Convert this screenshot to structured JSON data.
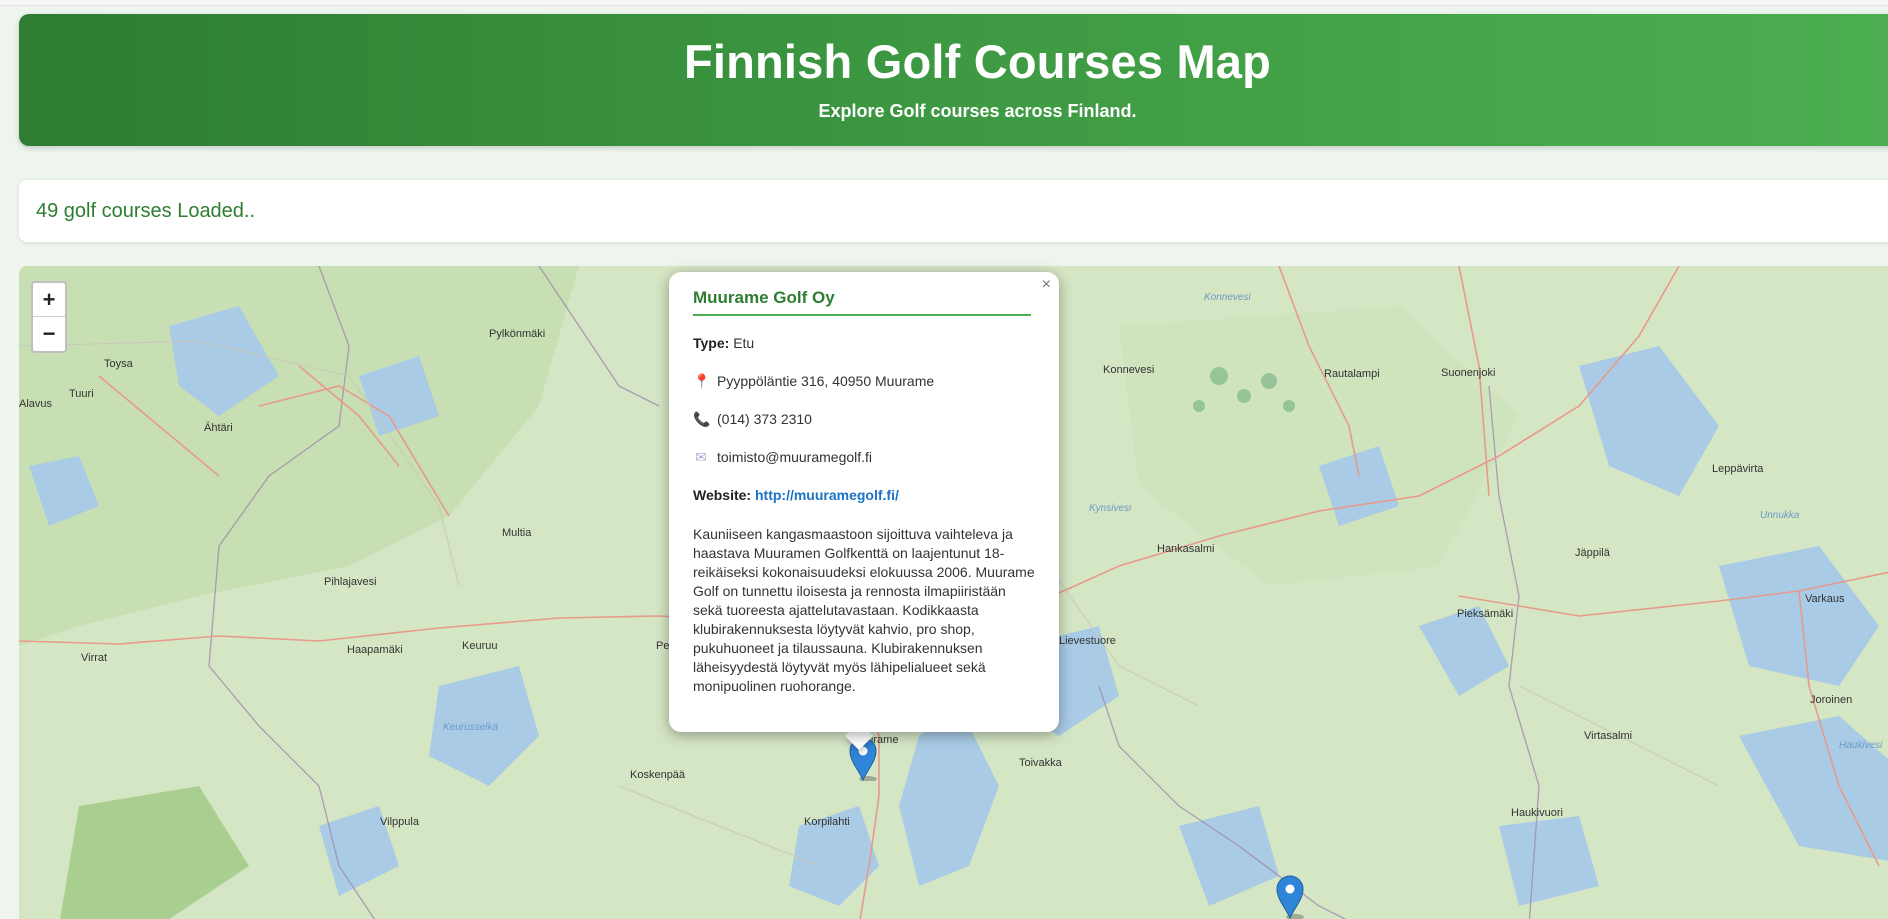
{
  "header": {
    "title": "Finnish Golf Courses Map",
    "subtitle": "Explore Golf courses across Finland."
  },
  "status": {
    "text": "49 golf courses Loaded.."
  },
  "map": {
    "zoom_in_label": "+",
    "zoom_out_label": "−",
    "places": [
      {
        "name": "Pylkönmäki"
      },
      {
        "name": "Toysa"
      },
      {
        "name": "Tuuri"
      },
      {
        "name": "Alavus"
      },
      {
        "name": "Ähtäri"
      },
      {
        "name": "Multia"
      },
      {
        "name": "Pihlajavesi"
      },
      {
        "name": "Haapamäki"
      },
      {
        "name": "Keuruu"
      },
      {
        "name": "Virrat"
      },
      {
        "name": "Koskenpää"
      },
      {
        "name": "Vilppula"
      },
      {
        "name": "Muurame"
      },
      {
        "name": "Korpilahti"
      },
      {
        "name": "Toivakka"
      },
      {
        "name": "Lievestuore"
      },
      {
        "name": "Hankasalmi"
      },
      {
        "name": "Konnevesi"
      },
      {
        "name": "Rautalampi"
      },
      {
        "name": "Suonenjoki"
      },
      {
        "name": "Leppävirta"
      },
      {
        "name": "Jäppilä"
      },
      {
        "name": "Pieksämäki"
      },
      {
        "name": "Varkaus"
      },
      {
        "name": "Joroinen"
      },
      {
        "name": "Virtasalmi"
      },
      {
        "name": "Haukivuori"
      },
      {
        "name": "Pe"
      }
    ],
    "water_labels": [
      {
        "name": "Konnevesi"
      },
      {
        "name": "Kynsivesi"
      },
      {
        "name": "Unnukka"
      },
      {
        "name": "Keurusselkä"
      },
      {
        "name": "Haukivesi"
      }
    ],
    "marker_color": "#2f86d8"
  },
  "popup": {
    "close_label": "×",
    "title": "Muurame Golf Oy",
    "type_label": "Type:",
    "type_value": "Etu",
    "address": "Pyyppöläntie 316, 40950 Muurame",
    "phone": "(014) 373 2310",
    "email": "toimisto@muuramegolf.fi",
    "website_label": "Website:",
    "website_url": "http://muuramegolf.fi/",
    "description": "Kauniiseen kangasmaastoon sijoittuva vaihteleva ja haastava Muuramen Golfkenttä on laajentunut 18-reikäiseksi kokonaisuudeksi elokuussa 2006. Muurame Golf on tunnettu iloisesta ja rennosta ilmapiiristään sekä tuoreesta ajattelutavastaan. Kodikkaasta klubirakennuksesta löytyvät kahvio, pro shop, pukuhuoneet ja tilaussauna. Klubirakennuksen läheisyydestä löytyvät myös lähipelialueet sekä monipuolinen ruohorange."
  }
}
